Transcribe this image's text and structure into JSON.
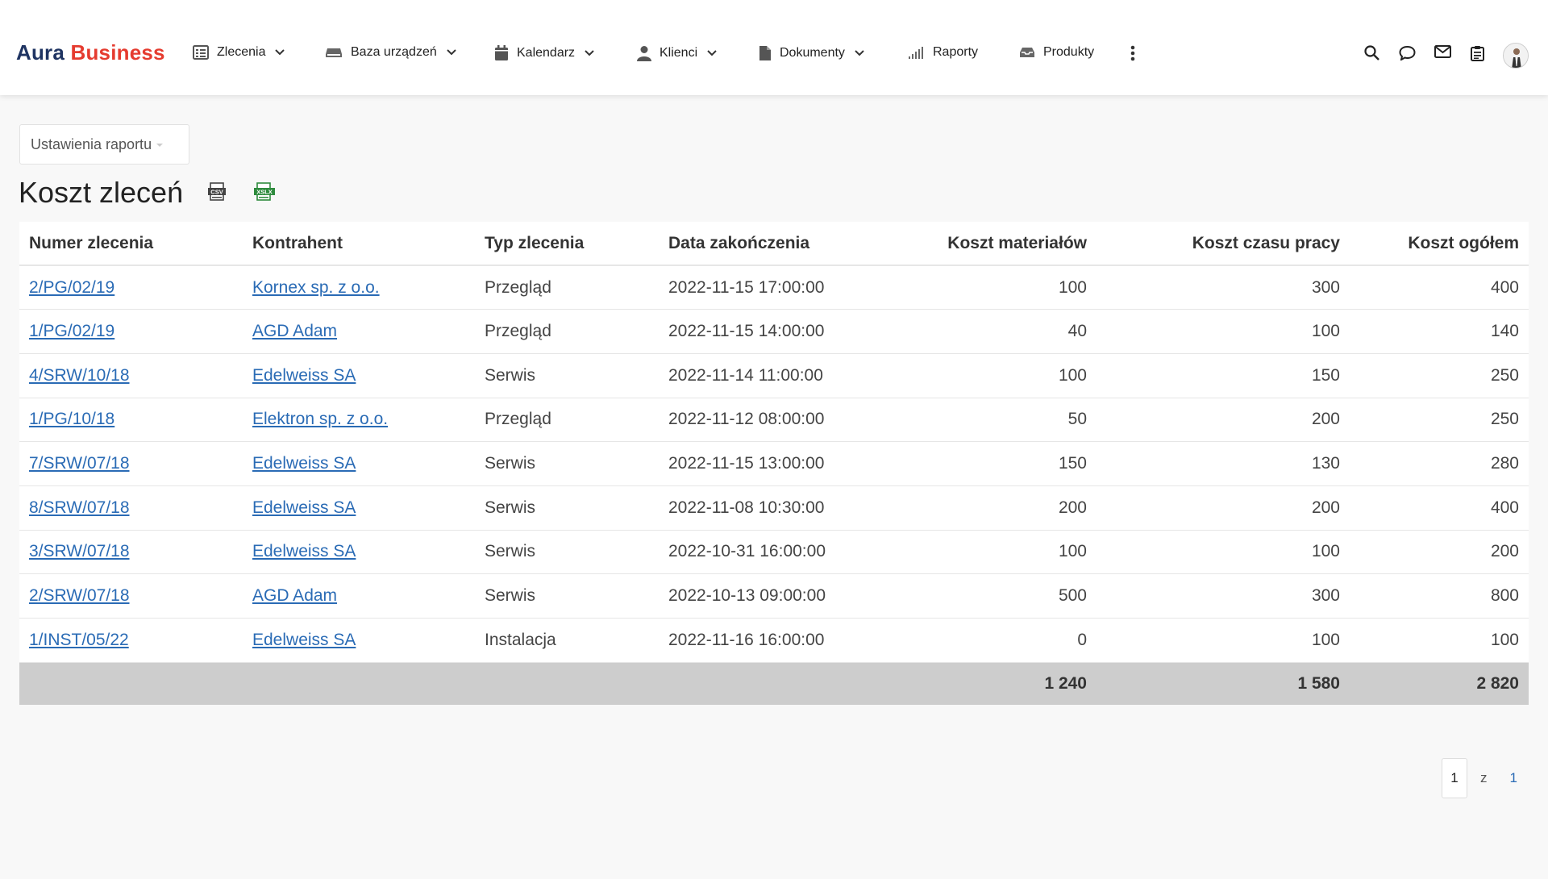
{
  "brand": {
    "part1": "Aura",
    "part2": "Business"
  },
  "nav": [
    {
      "label": "Zlecenia",
      "icon": "list-icon",
      "dropdown": true
    },
    {
      "label": "Baza urządzeń",
      "icon": "device-icon",
      "dropdown": true
    },
    {
      "label": "Kalendarz",
      "icon": "calendar-icon",
      "dropdown": true
    },
    {
      "label": "Klienci",
      "icon": "user-icon",
      "dropdown": true
    },
    {
      "label": "Dokumenty",
      "icon": "document-icon",
      "dropdown": true
    },
    {
      "label": "Raporty",
      "icon": "signal-bars-icon",
      "dropdown": false
    },
    {
      "label": "Produkty",
      "icon": "inbox-icon",
      "dropdown": false
    }
  ],
  "header_icons": [
    "more-vertical-icon",
    "search-icon",
    "chat-icon",
    "mail-icon",
    "clipboard-icon",
    "avatar"
  ],
  "settings": {
    "label": "Ustawienia raportu"
  },
  "page": {
    "title": "Koszt zleceń"
  },
  "exports": {
    "csv": "CSV",
    "xlsx": "XSLX"
  },
  "table": {
    "headers": [
      "Numer zlecenia",
      "Kontrahent",
      "Typ zlecenia",
      "Data zakończenia",
      "Koszt materiałów",
      "Koszt czasu pracy",
      "Koszt ogółem"
    ],
    "rows": [
      [
        "2/PG/02/19",
        "Kornex sp. z o.o.",
        "Przegląd",
        "2022-11-15 17:00:00",
        "100",
        "300",
        "400"
      ],
      [
        "1/PG/02/19",
        "AGD Adam",
        "Przegląd",
        "2022-11-15 14:00:00",
        "40",
        "100",
        "140"
      ],
      [
        "4/SRW/10/18",
        "Edelweiss SA",
        "Serwis",
        "2022-11-14 11:00:00",
        "100",
        "150",
        "250"
      ],
      [
        "1/PG/10/18",
        "Elektron sp. z o.o.",
        "Przegląd",
        "2022-11-12 08:00:00",
        "50",
        "200",
        "250"
      ],
      [
        "7/SRW/07/18",
        "Edelweiss SA",
        "Serwis",
        "2022-11-15 13:00:00",
        "150",
        "130",
        "280"
      ],
      [
        "8/SRW/07/18",
        "Edelweiss SA",
        "Serwis",
        "2022-11-08 10:30:00",
        "200",
        "200",
        "400"
      ],
      [
        "3/SRW/07/18",
        "Edelweiss SA",
        "Serwis",
        "2022-10-31 16:00:00",
        "100",
        "100",
        "200"
      ],
      [
        "2/SRW/07/18",
        "AGD Adam",
        "Serwis",
        "2022-10-13 09:00:00",
        "500",
        "300",
        "800"
      ],
      [
        "1/INST/05/22",
        "Edelweiss SA",
        "Instalacja",
        "2022-11-16 16:00:00",
        "0",
        "100",
        "100"
      ]
    ],
    "totals": {
      "materials": "1 240",
      "labor": "1 580",
      "overall": "2 820"
    }
  },
  "pagination": {
    "current": "1",
    "of": "z",
    "total": "1"
  },
  "colors": {
    "brand_dark": "#1f3462",
    "brand_red": "#e53b2f",
    "link": "#2a6bb5",
    "totals_bg": "#cdcdcd"
  }
}
